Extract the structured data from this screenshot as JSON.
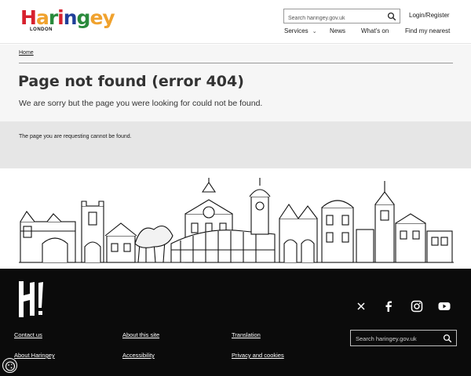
{
  "header": {
    "logo": {
      "word": "Haringey",
      "letters": [
        "H",
        "a",
        "r",
        "i",
        "n",
        "g",
        "ey"
      ],
      "sub": "LONDON"
    },
    "search": {
      "placeholder": "Search haringey.gov.uk"
    },
    "login_label": "Login/Register",
    "nav": {
      "services": "Services",
      "news": "News",
      "whats_on": "What's on",
      "find_nearest": "Find my nearest"
    }
  },
  "breadcrumb": {
    "home": "Home"
  },
  "page": {
    "title": "Page not found (error 404)",
    "lead": "We are sorry but the page you were looking for could not be found.",
    "message": "The page you are requesting cannot be found."
  },
  "footer": {
    "links": {
      "contact_us": "Contact us",
      "about_site": "About this site",
      "translation": "Translation",
      "about_haringey": "About Haringey",
      "accessibility": "Accessibility",
      "privacy": "Privacy and cookies"
    },
    "search": {
      "placeholder": "Search haringey.gov.uk"
    },
    "social": [
      "x-icon",
      "facebook-icon",
      "instagram-icon",
      "youtube-icon"
    ]
  },
  "colors": {
    "logo_red": "#d7212e",
    "logo_orange": "#f0a22e",
    "logo_green": "#2a8a3c",
    "logo_blue": "#1f3f99",
    "footer_bg": "#0b0b0b",
    "title_bg": "#f6f6f6",
    "message_bg": "#e6e6e6"
  }
}
